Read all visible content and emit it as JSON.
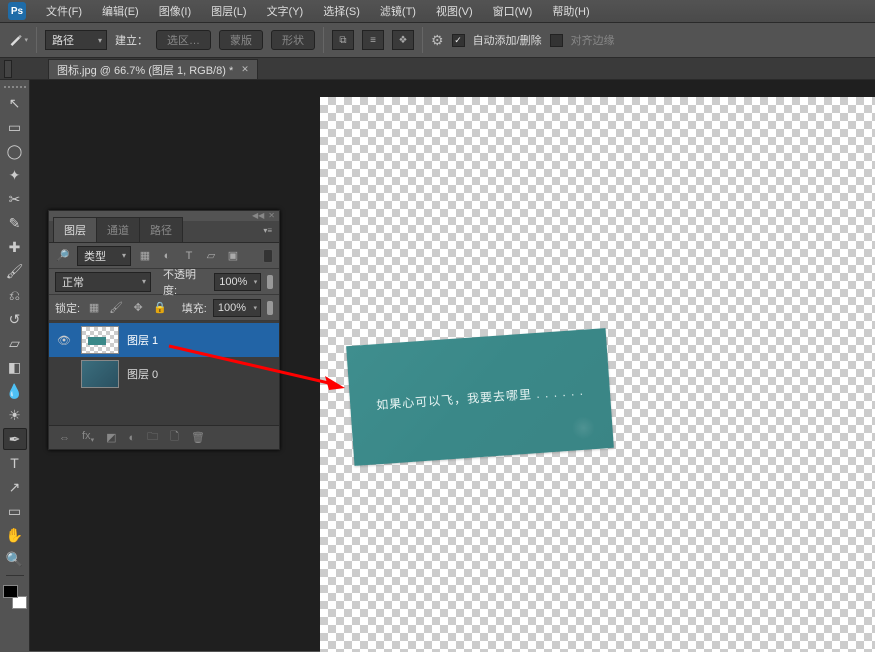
{
  "app": {
    "logo": "Ps"
  },
  "menu": {
    "items": [
      {
        "label": "文件(F)"
      },
      {
        "label": "编辑(E)"
      },
      {
        "label": "图像(I)"
      },
      {
        "label": "图层(L)"
      },
      {
        "label": "文字(Y)"
      },
      {
        "label": "选择(S)"
      },
      {
        "label": "滤镜(T)"
      },
      {
        "label": "视图(V)"
      },
      {
        "label": "窗口(W)"
      },
      {
        "label": "帮助(H)"
      }
    ]
  },
  "options": {
    "mode_select": "路径",
    "make_label": "建立：",
    "make_selection": "选区…",
    "make_mask": "蒙版",
    "make_shape": "形状",
    "auto_add_label": "自动添加/删除",
    "align_label": "对齐边缘"
  },
  "doc": {
    "tab_title": "图标.jpg @ 66.7% (图层 1, RGB/8) *"
  },
  "panel": {
    "tabs": {
      "layers": "图层",
      "channels": "通道",
      "paths": "路径"
    },
    "kind_select": "类型",
    "blend_mode": "正常",
    "opacity_label": "不透明度:",
    "opacity_value": "100%",
    "lock_label": "锁定:",
    "fill_label": "填充:",
    "fill_value": "100%",
    "layers": [
      {
        "name": "图层 1",
        "selected": true,
        "visible": true
      },
      {
        "name": "图层 0",
        "selected": false,
        "visible": false
      }
    ]
  },
  "canvas": {
    "card_text": "如果心可以飞，我要去哪里 . . . . . ."
  },
  "tools": {
    "move": "↖",
    "marquee": "▭",
    "lasso": "◯",
    "wand": "✦",
    "crop": "✂",
    "eyedropper": "✎",
    "heal": "✚",
    "brush": "🖌",
    "stamp": "⎌",
    "history": "↺",
    "eraser": "▱",
    "gradient": "◧",
    "blur": "💧",
    "dodge": "☀",
    "pen": "✒",
    "type": "T",
    "path": "↗",
    "rect": "▭",
    "hand": "✋",
    "zoom": "🔍"
  }
}
